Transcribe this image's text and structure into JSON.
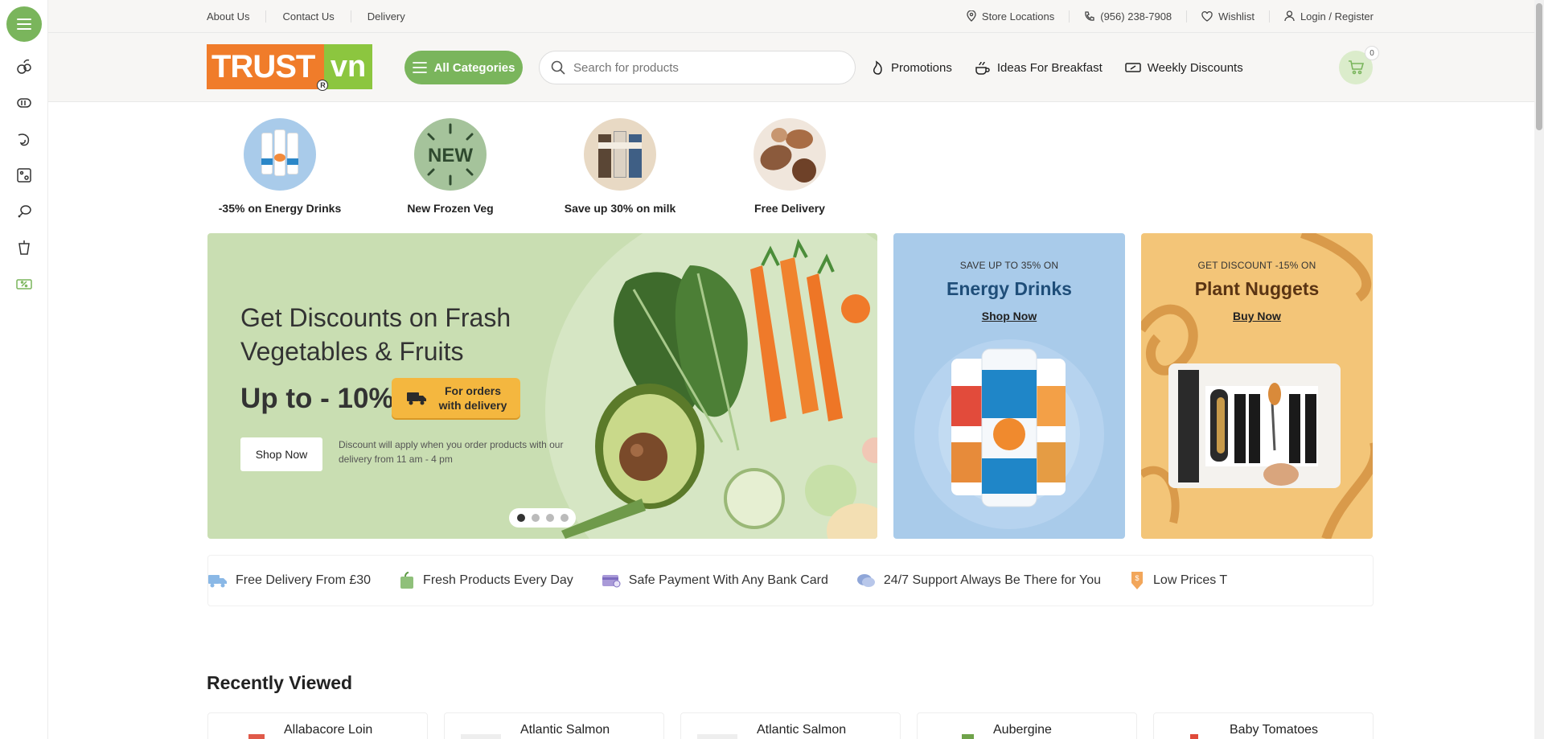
{
  "topbar": {
    "links": [
      "About Us",
      "Contact Us",
      "Delivery"
    ],
    "store_locations": "Store Locations",
    "phone": "(956) 238-7908",
    "wishlist": "Wishlist",
    "login": "Login / Register"
  },
  "header": {
    "logo_left": "TRUST",
    "logo_right": "vn",
    "all_categories": "All Categories",
    "search_placeholder": "Search for products",
    "nav": [
      "Promotions",
      "Ideas For Breakfast",
      "Weekly Discounts"
    ],
    "cart_count": "0"
  },
  "stories": [
    {
      "label": "-35% on Energy Drinks"
    },
    {
      "label": "New Frozen Veg",
      "badge": "NEW"
    },
    {
      "label": "Save up 30% on milk"
    },
    {
      "label": "Free Delivery"
    }
  ],
  "hero": {
    "title": "Get Discounts on Frash Vegetables & Fruits",
    "big": "Up to - 10%",
    "tag": "For orders with delivery",
    "button": "Shop Now",
    "note": "Discount will apply when you order products with our delivery from 11 am - 4 pm",
    "active_slide": 1,
    "slides": 4
  },
  "promos": [
    {
      "kicker": "SAVE UP TO 35% ON",
      "title": "Energy Drinks",
      "link": "Shop Now",
      "bg": "#a9cbea",
      "title_color": "#1f4e79"
    },
    {
      "kicker": "GET DISCOUNT -15% ON",
      "title": "Plant Nuggets",
      "link": "Buy Now",
      "bg": "#f3c578",
      "title_color": "#5a3413"
    }
  ],
  "features": [
    "Free Delivery From £30",
    "Fresh Products Every Day",
    "Safe Payment With Any Bank Card",
    "24/7 Support Always Be There for You",
    "Low Prices T"
  ],
  "recently_viewed": {
    "title": "Recently Viewed",
    "items": [
      "Allabacore Loin",
      "Atlantic Salmon",
      "Atlantic Salmon",
      "Aubergine",
      "Baby Tomatoes"
    ]
  },
  "colors": {
    "accent": "#7ab55c",
    "brand_orange": "#f07c2a",
    "brand_green": "#8cc63f"
  }
}
